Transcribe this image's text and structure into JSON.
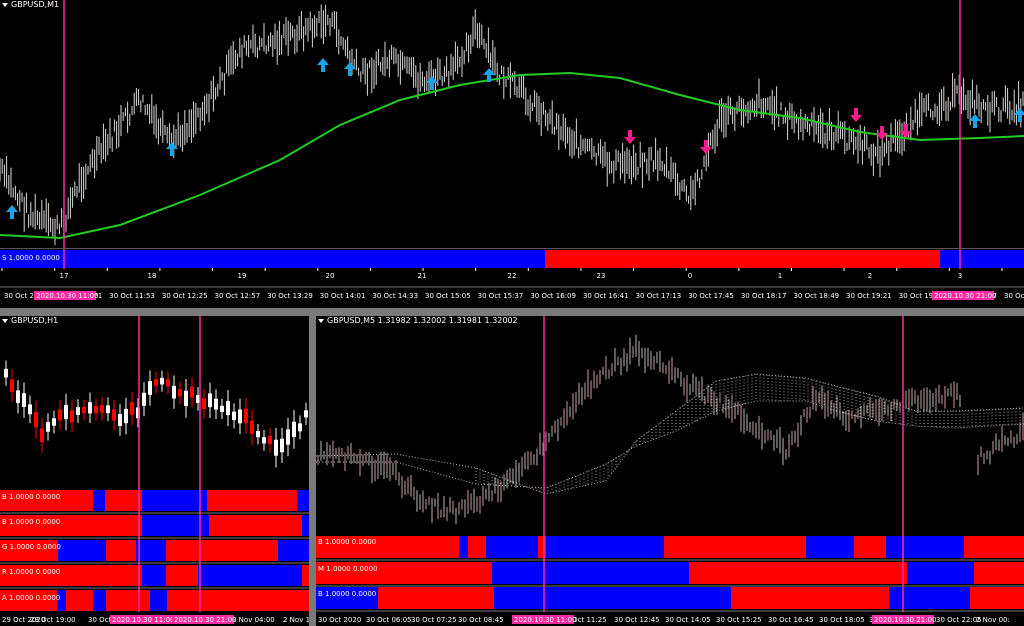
{
  "windows": {
    "m1": {
      "title": "GBPUSD,M1",
      "indicator_label": "S 1.0000 0.0000",
      "hour_labels": [
        "17",
        "18",
        "19",
        "20",
        "21",
        "22",
        "23",
        "0",
        "1",
        "2",
        "3"
      ],
      "time_labels": [
        "30 Oct 202",
        "30 Oct 11:21",
        "30 Oct 11:53",
        "30 Oct 12:25",
        "30 Oct 12:57",
        "30 Oct 13:29",
        "30 Oct 14:01",
        "30 Oct 14:33",
        "30 Oct 15:05",
        "30 Oct 15:37",
        "30 Oct 16:09",
        "30 Oct 16:41",
        "30 Oct 17:13",
        "30 Oct 17:45",
        "30 Oct 18:17",
        "30 Oct 18:49",
        "30 Oct 19:21",
        "30 Oct 19:53",
        "30 Oct 20:57",
        "30 Oct 21:"
      ],
      "highlight_labels": [
        "2020.10.30 11:00",
        "2020.10.30 21:00"
      ]
    },
    "h1": {
      "title": "GBPUSD,H1",
      "indicator_labels": [
        "B 1.0000 0.0000",
        "B 1.0000 0.0000",
        "G 1.0000 0.0000",
        "R 1.0000 0.0000",
        "A 1.0000 0.0000"
      ],
      "time_labels": [
        "29 Oct 2020",
        "29 Oct 19:00",
        "30 Oct",
        "2 Nov 04:00",
        "2 Nov 12"
      ],
      "highlight_labels": [
        "2020.10.30 11:00",
        "2020.10.30 21:00"
      ]
    },
    "m5": {
      "title": "GBPUSD,M5  1.31982 1.32002 1.31981 1.32002",
      "indicator_labels": [
        "B 1.0000 0.0000",
        "M 1.0000 0.0000",
        "B 1.0000 0.0000"
      ],
      "time_labels": [
        "30 Oct 2020",
        "30 Oct 06:05",
        "30 Oct 07:25",
        "30 Oct 08:45",
        "30 Oct 11:25",
        "30 Oct 12:45",
        "30 Oct 14:05",
        "30 Oct 15:25",
        "30 Oct 16:45",
        "30 Oct 18:05",
        "30 Oct 19:25",
        "30 Oct 22:05",
        "2 Nov 00:"
      ],
      "highlight_labels": [
        "2020.10.30 11:00",
        "2020.10.30 21:00"
      ]
    }
  },
  "colors": {
    "bull": "#ff0000",
    "bear": "#0000ff",
    "ma": "#22cc22",
    "vline": "#ff2aa0",
    "arrow_up": "#1aa3e8",
    "arrow_down": "#ff1a8c",
    "candle_up": "#ffffff",
    "candle_down": "#ff0000"
  },
  "icons": [
    "arrow-up-icon",
    "arrow-down-icon",
    "window-menu-triangle-icon"
  ]
}
